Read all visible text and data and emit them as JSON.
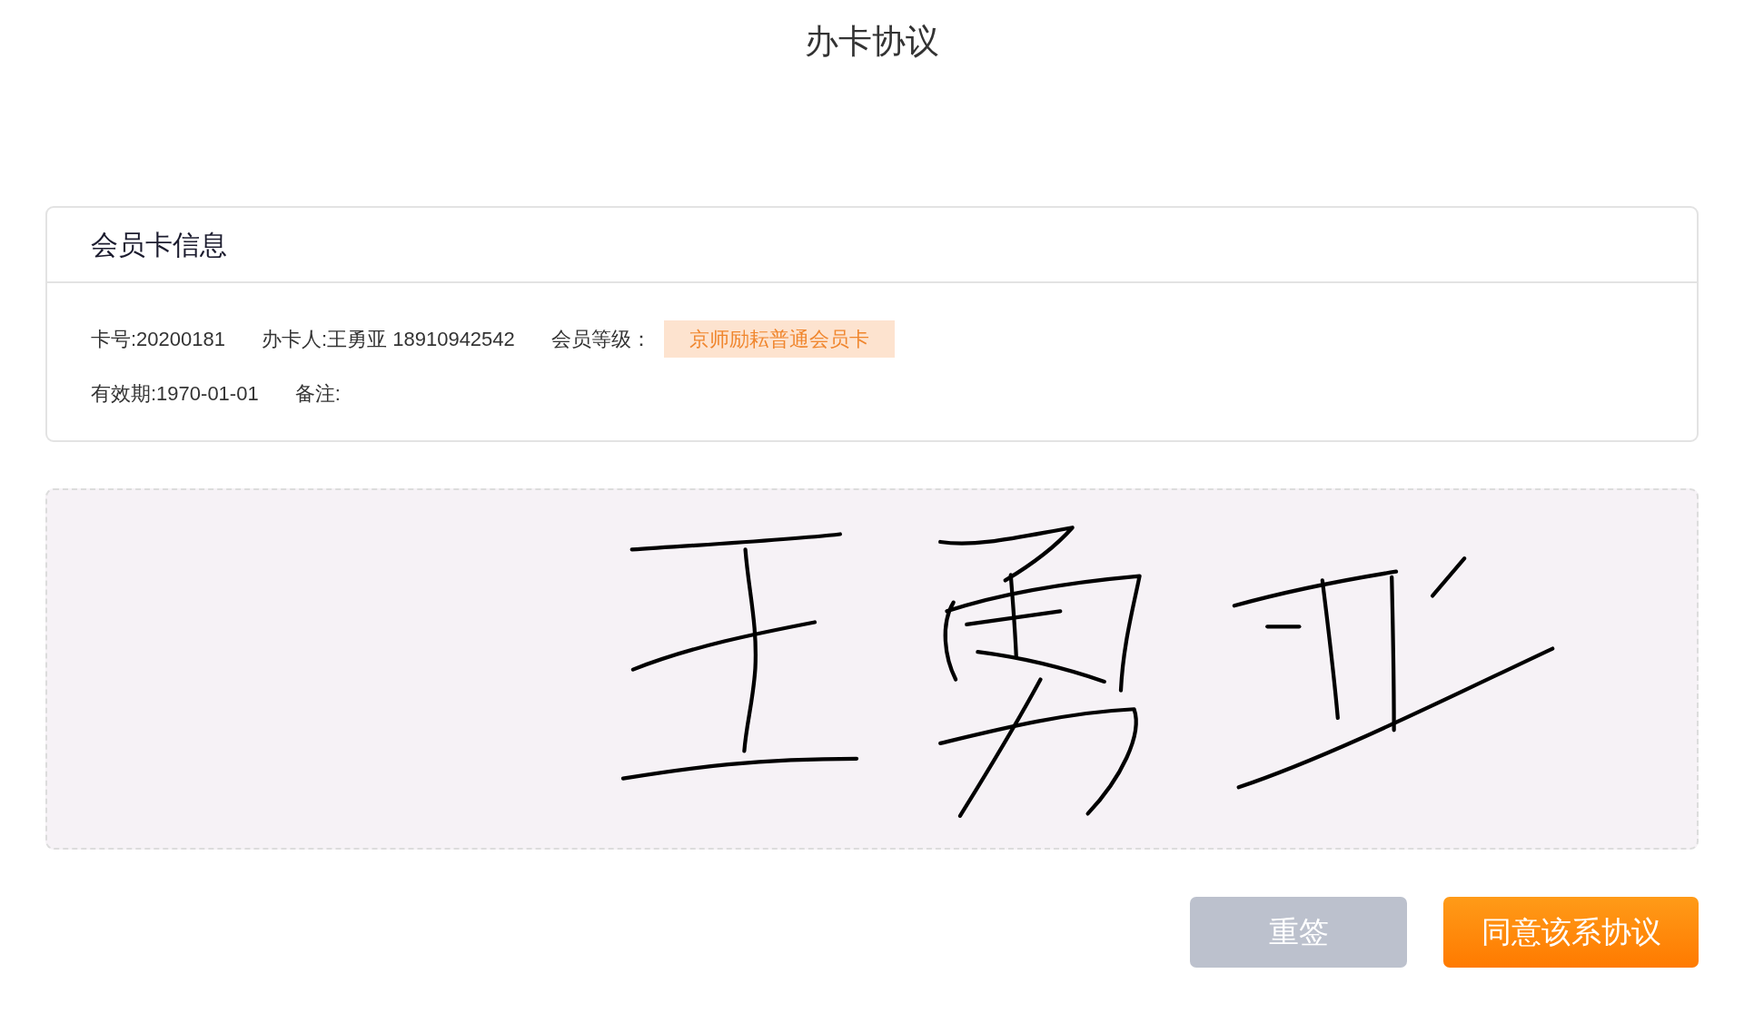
{
  "page": {
    "title": "办卡协议"
  },
  "card": {
    "title": "会员卡信息",
    "rows": [
      [
        {
          "kind": "text",
          "text": "卡号:20200181"
        },
        {
          "kind": "text",
          "text": "办卡人:王勇亚 18910942542"
        },
        {
          "kind": "badge",
          "label": "会员等级：",
          "badge": "京师励耘普通会员卡"
        }
      ],
      [
        {
          "kind": "text",
          "text": "有效期:1970-01-01"
        },
        {
          "kind": "text",
          "text": "备注:"
        }
      ]
    ]
  },
  "signature": {
    "signed": true
  },
  "buttons": [
    {
      "kind": "secondary",
      "label": "重签"
    },
    {
      "kind": "primary",
      "label": "同意该系协议"
    }
  ]
}
